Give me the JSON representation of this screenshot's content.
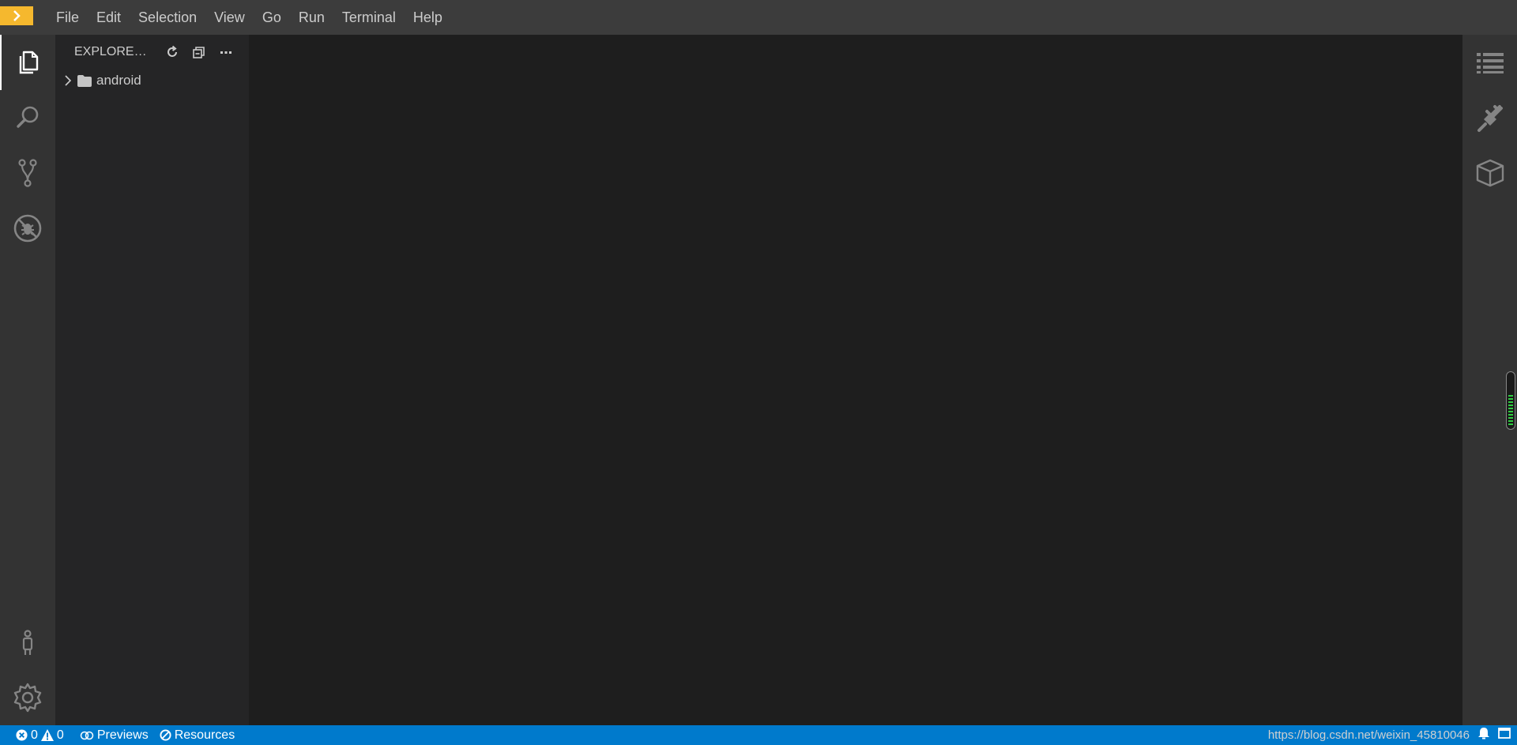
{
  "menu": [
    "File",
    "Edit",
    "Selection",
    "View",
    "Go",
    "Run",
    "Terminal",
    "Help"
  ],
  "activity_left": {
    "top": [
      "explorer-icon",
      "search-icon",
      "source-control-icon",
      "debug-icon"
    ],
    "bottom": [
      "account-icon",
      "settings-icon"
    ]
  },
  "explorer": {
    "title": "EXPLORE…",
    "actions": [
      "refresh-icon",
      "collapse-all-icon",
      "more-icon"
    ],
    "tree": [
      {
        "label": "android",
        "type": "folder",
        "expanded": false
      }
    ]
  },
  "activity_right": [
    "outline-icon",
    "plugin-icon",
    "package-icon"
  ],
  "resource_meter": {
    "level_percent": 55,
    "color": "#2ecc40"
  },
  "statusbar": {
    "errors": "0",
    "warnings": "0",
    "previews": "Previews",
    "resources": "Resources",
    "watermark": "https://blog.csdn.net/weixin_45810046"
  },
  "colors": {
    "menubar": "#3c3c3c",
    "activity": "#333333",
    "sidebar": "#252526",
    "editor": "#1e1e1e",
    "status": "#007acc",
    "logo": "#f5b82e"
  }
}
